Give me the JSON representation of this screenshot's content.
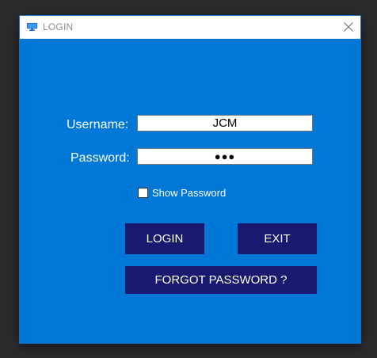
{
  "window": {
    "title": "LOGIN",
    "icon": "monitor-icon",
    "close_icon": "close-icon"
  },
  "form": {
    "username_label": "Username:",
    "username_value": "JCM",
    "password_label": "Password:",
    "password_value": "●●●",
    "show_password_label": "Show Password",
    "show_password_checked": false
  },
  "buttons": {
    "login": "LOGIN",
    "exit": "EXIT",
    "forgot_password": "FORGOT PASSWORD ?"
  },
  "colors": {
    "window_background": "#0078d7",
    "button_background": "#191970",
    "button_text": "#ffffff",
    "desktop_background": "#2b2b2d"
  }
}
